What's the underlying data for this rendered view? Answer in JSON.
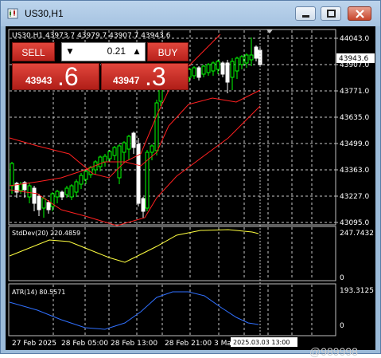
{
  "window": {
    "title": "US30,H1"
  },
  "chart_header": "US30,H1  43973.7 43979.7 43907.7 43943.6",
  "trade_panel": {
    "sell_label": "SELL",
    "buy_label": "BUY",
    "lot_value": "0.21",
    "bid_main": "43943",
    "bid_frac": ".6",
    "ask_main": "43947",
    "ask_frac": ".3"
  },
  "price_axis": {
    "labels": [
      "44043.0",
      "43907.0",
      "43771.0",
      "43635.0",
      "43499.0",
      "43363.0",
      "43227.0",
      "43095.0"
    ],
    "current_price": "43943.6"
  },
  "stddev_panel": {
    "label": "StdDev(20) 220.4859",
    "max": "247.7432",
    "min": "0"
  },
  "atr_panel": {
    "label": "ATR(14) 80.5571",
    "max": "193.3125",
    "min": "0"
  },
  "time_axis": {
    "labels": [
      "27 Feb 2025",
      "28 Feb 05:00",
      "28 Feb 13:00",
      "28 Feb 21:00",
      "3 Ma"
    ],
    "crosshair_time": "2025.03.03 13:00"
  },
  "watermark": "@989998",
  "colors": {
    "bull": "#00ff00",
    "bear": "#ffffff",
    "band": "#ff2020",
    "stddev": "#ffff40",
    "atr": "#3070ff",
    "panel_red": "#cc2a22"
  },
  "candles_icon": "chart-candles-icon"
}
